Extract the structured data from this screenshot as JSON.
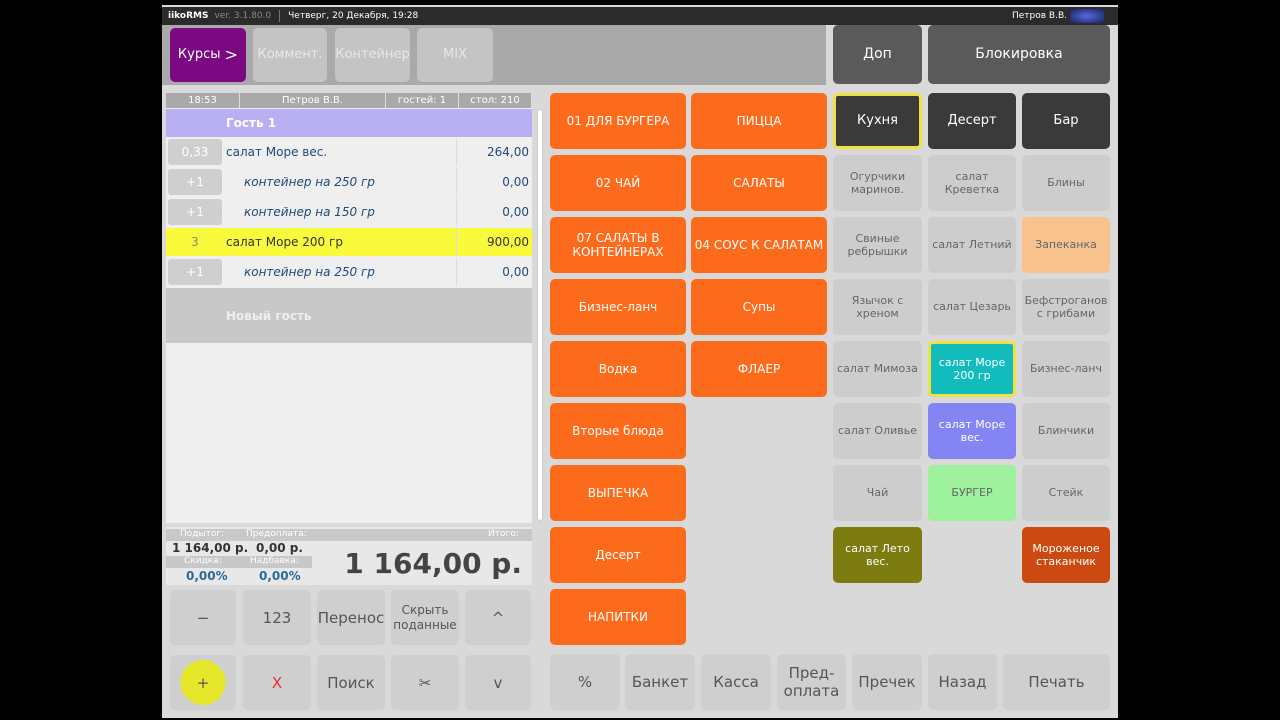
{
  "topbar": {
    "app": "iikoRMS",
    "version": "ver. 3.1.80.0",
    "datetime": "Четверг, 20 Декабря, 19:28",
    "user": "Петров В.В."
  },
  "header": {
    "courses": "Курсы",
    "courses_arrow": ">",
    "comment": "Коммент.",
    "container": "Контейнер",
    "mix": "MIX",
    "extra": "Доп",
    "lock": "Блокировка"
  },
  "order": {
    "time": "18:53",
    "waiter": "Петров В.В.",
    "guests": "гостей: 1",
    "table": "стол: 210",
    "guest": "Гость 1",
    "new_guest": "Новый гость",
    "items": [
      {
        "qty": "0,33",
        "name": "салат Море вес.",
        "price": "264,00",
        "mod": false,
        "selected": false
      },
      {
        "qty": "+1",
        "name": "контейнер на 250 гр",
        "price": "0,00",
        "mod": true,
        "selected": false
      },
      {
        "qty": "+1",
        "name": "контейнер на 150 гр",
        "price": "0,00",
        "mod": true,
        "selected": false
      },
      {
        "qty": "3",
        "name": "салат Море 200 гр",
        "price": "900,00",
        "mod": false,
        "selected": true
      },
      {
        "qty": "+1",
        "name": "контейнер на 250 гр",
        "price": "0,00",
        "mod": true,
        "selected": false
      }
    ]
  },
  "summary": {
    "subtotal_label": "Подытог:",
    "subtotal": "1 164,00 р.",
    "prepay_label": "Предоплата:",
    "prepay": "0,00 р.",
    "discount_label": "Скидка:",
    "discount": "0,00%",
    "markup_label": "Надбавка:",
    "markup": "0,00%",
    "total_label": "Итого:",
    "total": "1 164,00 р."
  },
  "left_buttons": [
    "−",
    "123",
    "Перенос",
    "Скрыть поданные",
    "^",
    "+",
    "X",
    "Поиск",
    "✂",
    "v"
  ],
  "categories": [
    [
      "01 ДЛЯ БУРГЕРА",
      "ПИЦЦА"
    ],
    [
      "02 ЧАЙ",
      "САЛАТЫ"
    ],
    [
      "07 САЛАТЫ В КОНТЕЙНЕРАХ",
      "04 СОУС К САЛАТАМ"
    ],
    [
      "Бизнес-ланч",
      "Супы"
    ],
    [
      "Водка",
      "ФЛАЕР"
    ],
    [
      "Вторые блюда",
      ""
    ],
    [
      "ВЫПЕЧКА",
      ""
    ],
    [
      "Десерт",
      ""
    ],
    [
      "НАПИТКИ",
      ""
    ]
  ],
  "products": [
    [
      {
        "t": "Кухня",
        "c": "#3a3a3a",
        "f": "#fff",
        "b": "#f0e040"
      },
      {
        "t": "Десерт",
        "c": "#3a3a3a",
        "f": "#fff"
      },
      {
        "t": "Бар",
        "c": "#3a3a3a",
        "f": "#fff"
      }
    ],
    [
      {
        "t": "Огурчики маринов."
      },
      {
        "t": "салат Креветка"
      },
      {
        "t": "Блины"
      }
    ],
    [
      {
        "t": "Свиные ребрышки"
      },
      {
        "t": "салат Летний"
      },
      {
        "t": "Запеканка",
        "c": "#f8c28e"
      }
    ],
    [
      {
        "t": "Язычок с хреном"
      },
      {
        "t": "салат Цезарь"
      },
      {
        "t": "Бефстроганов с грибами"
      }
    ],
    [
      {
        "t": "салат Мимоза"
      },
      {
        "t": "салат Море 200 гр",
        "c": "#12bcbc",
        "f": "#fff",
        "b": "#f0e040"
      },
      {
        "t": "Бизнес-ланч"
      }
    ],
    [
      {
        "t": "салат Оливье"
      },
      {
        "t": "салат Море вес.",
        "c": "#8484f2",
        "f": "#fff"
      },
      {
        "t": "Блинчики"
      }
    ],
    [
      {
        "t": "Чай"
      },
      {
        "t": "БУРГЕР",
        "c": "#9ef29e",
        "f": "#666"
      },
      {
        "t": "Стейк"
      }
    ],
    [
      {
        "t": "салат Лето вес.",
        "c": "#7c7c10",
        "f": "#fff"
      },
      null,
      {
        "t": "Мороженое стаканчик",
        "c": "#cc4a12",
        "f": "#fff"
      }
    ]
  ],
  "bottom_buttons": [
    "%",
    "Банкет",
    "Касса",
    "Пред-оплата",
    "Пречек",
    "Назад",
    "Печать"
  ]
}
